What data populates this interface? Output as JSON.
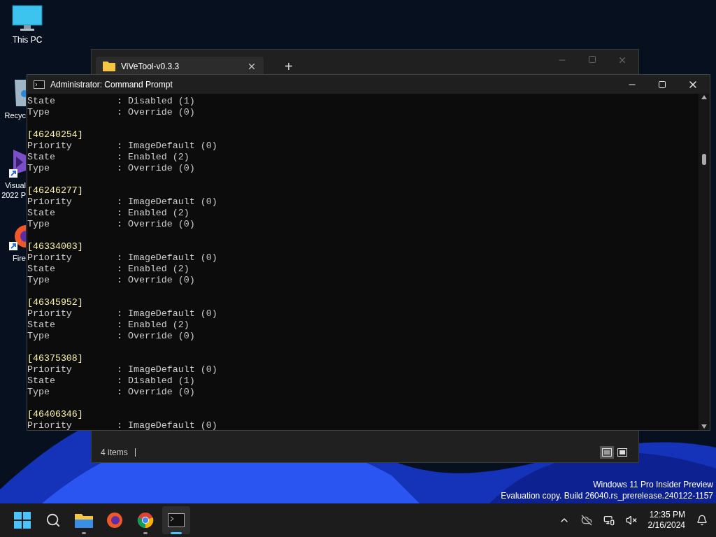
{
  "desktop_icons": [
    {
      "label": "This PC",
      "kind": "monitor"
    },
    {
      "label": "Recyc",
      "kind": "bin"
    },
    {
      "label": "Visual\n2022 P",
      "kind": "vs"
    },
    {
      "label": "Fire",
      "kind": "firefox"
    }
  ],
  "explorer": {
    "tab": {
      "title": "ViVeTool-v0.3.3",
      "selected": true
    },
    "new_tab": "+",
    "status": "4 items",
    "details_view": {
      "selected": true
    },
    "tiles_view": {
      "selected": false
    }
  },
  "console": {
    "title": "Administrator: Command Prompt",
    "blocks": [
      {
        "fields": [
          {
            "name": "State",
            "value": ": Disabled (1)"
          },
          {
            "name": "Type",
            "value": ": Override (0)"
          }
        ]
      },
      {
        "id": "[46240254]",
        "fields": [
          {
            "name": "Priority",
            "value": ": ImageDefault (0)"
          },
          {
            "name": "State",
            "value": ": Enabled (2)"
          },
          {
            "name": "Type",
            "value": ": Override (0)"
          }
        ]
      },
      {
        "id": "[46246277]",
        "fields": [
          {
            "name": "Priority",
            "value": ": ImageDefault (0)"
          },
          {
            "name": "State",
            "value": ": Enabled (2)"
          },
          {
            "name": "Type",
            "value": ": Override (0)"
          }
        ]
      },
      {
        "id": "[46334003]",
        "fields": [
          {
            "name": "Priority",
            "value": ": ImageDefault (0)"
          },
          {
            "name": "State",
            "value": ": Enabled (2)"
          },
          {
            "name": "Type",
            "value": ": Override (0)"
          }
        ]
      },
      {
        "id": "[46345952]",
        "fields": [
          {
            "name": "Priority",
            "value": ": ImageDefault (0)"
          },
          {
            "name": "State",
            "value": ": Enabled (2)"
          },
          {
            "name": "Type",
            "value": ": Override (0)"
          }
        ]
      },
      {
        "id": "[46375308]",
        "fields": [
          {
            "name": "Priority",
            "value": ": ImageDefault (0)"
          },
          {
            "name": "State",
            "value": ": Disabled (1)"
          },
          {
            "name": "Type",
            "value": ": Override (0)"
          }
        ]
      },
      {
        "id": "[46406346]",
        "fields": [
          {
            "name": "Priority",
            "value": ": ImageDefault (0)"
          }
        ]
      }
    ]
  },
  "watermark": [
    "Windows 11 Pro Insider Preview",
    "Evaluation copy. Build 26040.rs_prerelease.240122-1157"
  ],
  "taskbar": {
    "apps": [
      {
        "kind": "start",
        "running": false,
        "selected": false
      },
      {
        "kind": "search",
        "running": false,
        "selected": false
      },
      {
        "kind": "explorer",
        "running": true,
        "selected": false
      },
      {
        "kind": "firefox",
        "running": false,
        "selected": false
      },
      {
        "kind": "chrome",
        "running": true,
        "selected": false
      },
      {
        "kind": "terminal",
        "running": true,
        "selected": true
      }
    ],
    "time": "12:35 PM",
    "date": "2/16/2024"
  }
}
